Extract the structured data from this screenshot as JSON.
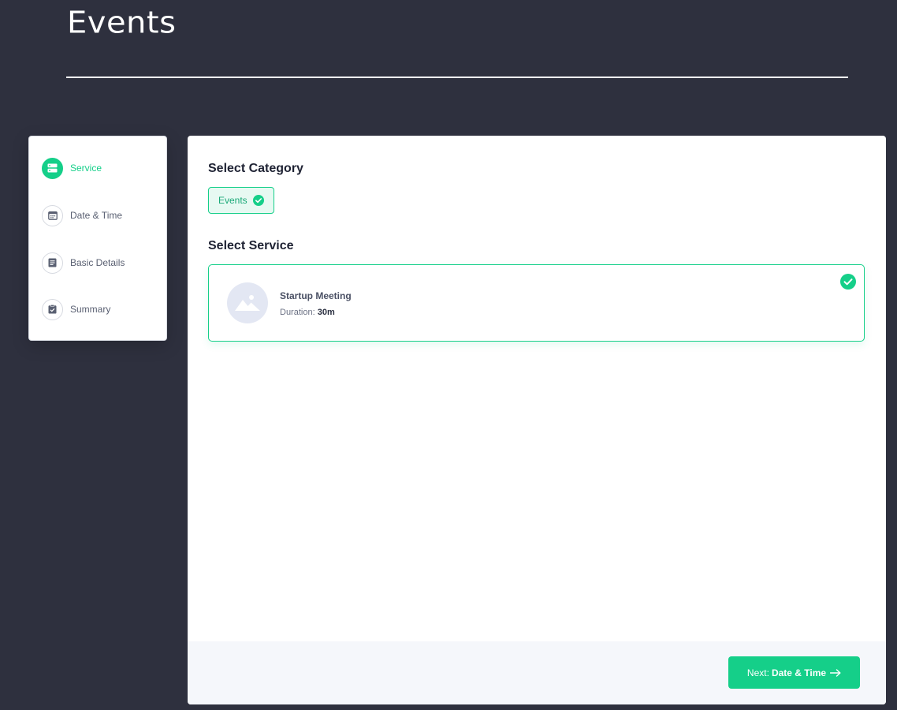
{
  "page": {
    "title": "Events"
  },
  "stepper": {
    "steps": [
      {
        "label": "Service",
        "icon": "service-icon",
        "active": true
      },
      {
        "label": "Date & Time",
        "icon": "calendar-icon",
        "active": false
      },
      {
        "label": "Basic Details",
        "icon": "document-icon",
        "active": false
      },
      {
        "label": "Summary",
        "icon": "clipboard-check-icon",
        "active": false
      }
    ]
  },
  "main": {
    "category_heading": "Select Category",
    "category_chip": "Events",
    "service_heading": "Select Service",
    "service": {
      "name": "Startup Meeting",
      "duration_label": "Duration:",
      "duration_value": "30m"
    }
  },
  "footer": {
    "next_prefix": "Next:",
    "next_target": "Date & Time"
  },
  "colors": {
    "background": "#2e303e",
    "accent": "#15cf89",
    "panel": "#ffffff",
    "footer": "#f5f7fb"
  }
}
